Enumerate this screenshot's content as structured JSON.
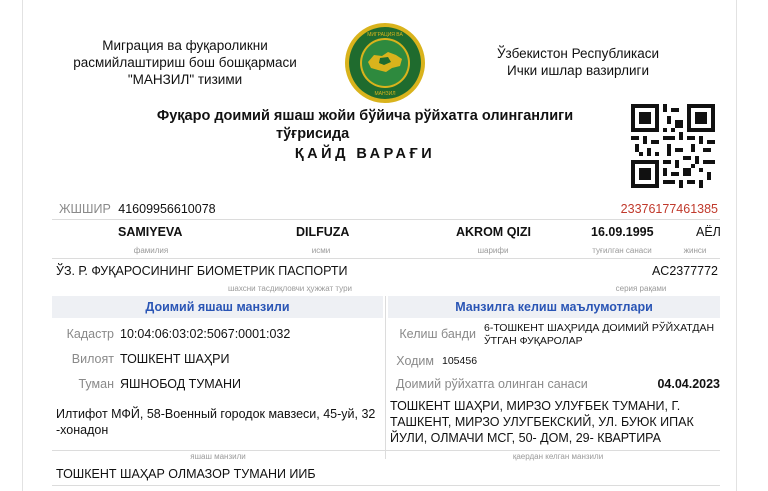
{
  "header": {
    "left_lines": [
      "Миграция ва фуқароликни",
      "расмийлаштириш бош бошқармаси",
      "\"МАНЗИЛ\" тизими"
    ],
    "right_lines": [
      "Ўзбекистон Республикаси",
      "Ички ишлар вазирлиги"
    ]
  },
  "title": {
    "line1": "Фуқаро доимий яшаш жойи бўйича рўйхатга олинганлиги",
    "line2": "тўғрисида",
    "line3": "ҚАЙД ВАРАҒИ"
  },
  "person": {
    "jshshir_label": "ЖШШИР",
    "jshshir_value": "41609956610078",
    "record_number": "23376177461385",
    "surname": "SAMIYEVA",
    "name": "DILFUZA",
    "patronymic": "AKROM QIZI",
    "birth_date": "16.09.1995",
    "gender": "АЁЛ",
    "captions": {
      "surname": "фамилия",
      "name": "исми",
      "patronymic": "шарифи",
      "birth_date": "туғилган санаси",
      "gender": "жинси"
    }
  },
  "document": {
    "type": "ЎЗ. Р. ФУҚАРОСИНИНГ БИОМЕТРИК ПАСПОРТИ",
    "series": "AC2377772",
    "type_caption": "шахсни тасдиқловчи ҳужжат тури",
    "series_caption": "серия рақами"
  },
  "permanent_address": {
    "heading": "Доимий яшаш манзили",
    "cadastre_label": "Кадастр",
    "cadastre_value": "10:04:06:03:02:5067:0001:032",
    "region_label": "Вилоят",
    "region_value": "ТОШКЕНТ ШАҲРИ",
    "district_label": "Туман",
    "district_value": "ЯШНОБОД ТУМАНИ",
    "address_line1": "Илтифот МФЙ, 58-Военный городок мавзеси, 45-уй, 32",
    "address_line2": "-хонадон",
    "caption": "яшаш манзили"
  },
  "arrival": {
    "heading": "Манзилга келиш маълумотлари",
    "arrival_label": "Келиш банди",
    "arrival_value_line1": "6-ТОШКЕНТ ШАҲРИДА ДОИМИЙ РЎЙХАТДАН",
    "arrival_value_line2": "ЎТГАН ФУҚАРОЛАР",
    "code_label": "Ходим",
    "code_value": "105456",
    "reg_date_label": "Доимий рўйхатга олинган санаси",
    "reg_date_value": "04.04.2023",
    "from_line1": "ТОШКЕНТ ШАҲРИ, МИРЗО УЛУҒБЕК ТУМАНИ, Г.",
    "from_line2": "ТАШКЕНТ, МИРЗО УЛУГБЕКСКИЙ, УЛ. БУЮК ИПАК",
    "from_line3": "ЙУЛИ, ОЛМАЧИ МСГ, 50- ДОМ, 29- КВАРТИРА",
    "from_caption": "қаердан келган манзили"
  },
  "office": {
    "value": "ТОШКЕНТ ШАҲАР ОЛМАЗОР ТУМАНИ ИИБ"
  },
  "colors": {
    "accent_blue": "#2a55b5",
    "record_red": "#c0392b",
    "emblem_green": "#1f6b2e",
    "emblem_gold": "#d9b31c"
  }
}
